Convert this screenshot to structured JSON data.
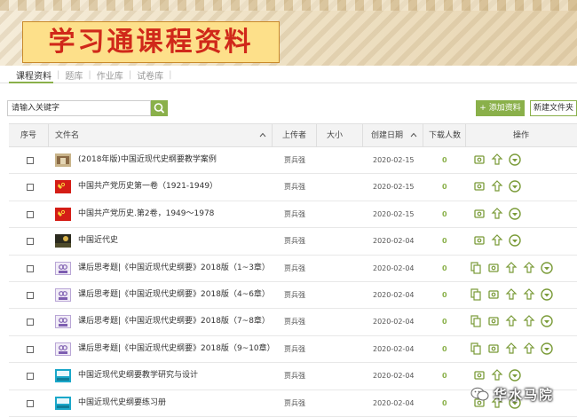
{
  "banner": {
    "title": "学习通课程资料"
  },
  "tabs": [
    {
      "label": "课程资料",
      "active": true
    },
    {
      "label": "题库"
    },
    {
      "label": "作业库"
    },
    {
      "label": "试卷库"
    }
  ],
  "search": {
    "placeholder": "请输入关键字",
    "value": "请输入关键字"
  },
  "toolbar": {
    "add_label": "+ 添加资料",
    "new_folder_label": "新建文件夹"
  },
  "table": {
    "headers": {
      "index": "序号",
      "filename": "文件名",
      "uploader": "上传者",
      "size": "大小",
      "created": "创建日期",
      "downloads": "下载人数",
      "actions": "操作"
    },
    "rows": [
      {
        "name": "(2018年版)中国近现代史纲要教学案例",
        "uploader": "贾兵强",
        "date": "2020-02-15",
        "downloads": "0",
        "thumb": "photo-thumbnail",
        "ops": [
          "view",
          "upload",
          "more"
        ]
      },
      {
        "name": "中国共产党历史第一卷（1921-1949）",
        "uploader": "贾兵强",
        "date": "2020-02-15",
        "downloads": "0",
        "thumb": "party-flag-thumbnail",
        "ops": [
          "view",
          "upload",
          "more"
        ]
      },
      {
        "name": "中国共产党历史.第2卷，1949～1978",
        "uploader": "贾兵强",
        "date": "2020-02-15",
        "downloads": "0",
        "thumb": "party-flag-thumbnail",
        "ops": [
          "view",
          "upload",
          "more"
        ]
      },
      {
        "name": "中国近代史",
        "uploader": "贾兵强",
        "date": "2020-02-04",
        "downloads": "0",
        "thumb": "dark-photo-thumbnail",
        "ops": [
          "view",
          "upload",
          "more"
        ]
      },
      {
        "name": "课后思考题|《中国近现代史纲要》2018版（1~3章）",
        "uploader": "贾兵强",
        "date": "2020-02-04",
        "downloads": "0",
        "thumb": "url-link-thumbnail",
        "ops": [
          "copy",
          "view",
          "upload",
          "upload",
          "more"
        ]
      },
      {
        "name": "课后思考题|《中国近现代史纲要》2018版（4~6章）",
        "uploader": "贾兵强",
        "date": "2020-02-04",
        "downloads": "0",
        "thumb": "url-link-thumbnail",
        "ops": [
          "copy",
          "view",
          "upload",
          "upload",
          "more"
        ]
      },
      {
        "name": "课后思考题|《中国近现代史纲要》2018版（7~8章）",
        "uploader": "贾兵强",
        "date": "2020-02-04",
        "downloads": "0",
        "thumb": "url-link-thumbnail",
        "ops": [
          "copy",
          "view",
          "upload",
          "upload",
          "more"
        ]
      },
      {
        "name": "课后思考题|《中国近现代史纲要》2018版（9~10章）",
        "uploader": "贾兵强",
        "date": "2020-02-04",
        "downloads": "0",
        "thumb": "url-link-thumbnail",
        "ops": [
          "copy",
          "view",
          "upload",
          "upload",
          "more"
        ]
      },
      {
        "name": "中国近现代史纲要教学研究与设计",
        "uploader": "贾兵强",
        "date": "2020-02-04",
        "downloads": "0",
        "thumb": "book-thumbnail",
        "ops": [
          "view",
          "upload",
          "more"
        ]
      },
      {
        "name": "中国近现代史纲要练习册",
        "uploader": "贾兵强",
        "date": "2020-02-04",
        "downloads": "0",
        "thumb": "book-thumbnail",
        "ops": [
          "view",
          "upload",
          "more"
        ]
      }
    ]
  },
  "watermark": {
    "text": "华水马院"
  },
  "colors": {
    "accent": "#8ab04a",
    "title_red": "#d0281a",
    "title_bg": "#fde08a"
  }
}
